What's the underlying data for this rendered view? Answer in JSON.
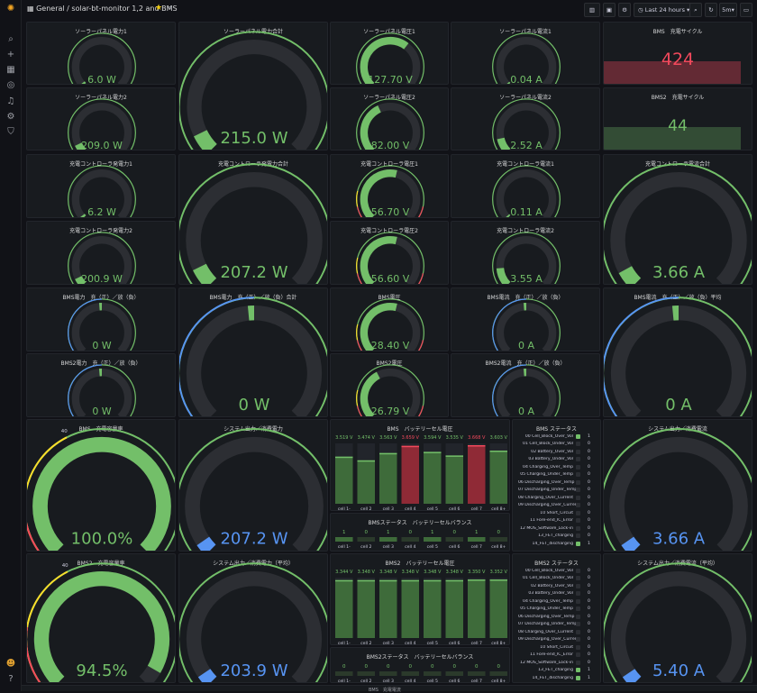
{
  "header": {
    "breadcrumb": "General / solar-bt-monitor 1,2 and BMS",
    "time_range": "Last 24 hours",
    "refresh": "5m"
  },
  "colors": {
    "green": "#73bf69",
    "red": "#f2495c",
    "blue": "#5794f2",
    "yellow": "#fade2a",
    "track": "#2c2e33"
  },
  "gauges": [
    {
      "id": "g1",
      "title": "ソーラーパネル電力1",
      "value": "6.0 W",
      "fill": 0.02,
      "color": "green"
    },
    {
      "id": "g2",
      "title": "ソーラーパネル電力2",
      "value": "209.0 W",
      "fill": 0.07,
      "color": "green"
    },
    {
      "id": "g3",
      "title": "ソーラーパネル電力合計",
      "value": "215.0 W",
      "fill": 0.07,
      "color": "green",
      "min": "0",
      "max": "3000"
    },
    {
      "id": "g4",
      "title": "ソーラーパネル電圧1",
      "value": "127.70 V",
      "fill": 0.64,
      "color": "green"
    },
    {
      "id": "g5",
      "title": "ソーラーパネル電圧2",
      "value": "82.00 V",
      "fill": 0.41,
      "color": "green"
    },
    {
      "id": "g6",
      "title": "ソーラーパネル電流1",
      "value": "0.04 A",
      "fill": 0.01,
      "color": "green"
    },
    {
      "id": "g7",
      "title": "ソーラーパネル電流2",
      "value": "2.52 A",
      "fill": 0.12,
      "color": "green"
    },
    {
      "id": "g8",
      "title": "充電コントローラ発電力1",
      "value": "6.2 W",
      "fill": 0.02,
      "color": "green"
    },
    {
      "id": "g9",
      "title": "充電コントローラ発電力2",
      "value": "200.9 W",
      "fill": 0.07,
      "color": "green"
    },
    {
      "id": "g10",
      "title": "充電コントローラ発電力合計",
      "value": "207.2 W",
      "fill": 0.07,
      "color": "green",
      "min": "0",
      "max": "3000"
    },
    {
      "id": "g11",
      "title": "充電コントローラ電圧1",
      "value": "56.70 V",
      "fill": 0.55,
      "color": "green",
      "min": "24.0",
      "max": "0.1"
    },
    {
      "id": "g12",
      "title": "充電コントローラ電圧2",
      "value": "56.60 V",
      "fill": 0.55,
      "color": "green",
      "min": "24.0",
      "max": "0.1"
    },
    {
      "id": "g13",
      "title": "充電コントローラ電流1",
      "value": "0.11 A",
      "fill": 0.01,
      "color": "green"
    },
    {
      "id": "g14",
      "title": "充電コントローラ電流2",
      "value": "3.55 A",
      "fill": 0.15,
      "color": "green"
    },
    {
      "id": "g15",
      "title": "充電コントローラ電流合計",
      "value": "3.66 A",
      "fill": 0.06,
      "color": "green"
    },
    {
      "id": "g16",
      "title": "BMS電力　充（正）／放（負）",
      "value": "0 W",
      "fill": 0.5,
      "color": "green",
      "startColor": "blue"
    },
    {
      "id": "g17",
      "title": "BMS2電力　充（正）／放（負）",
      "value": "0 W",
      "fill": 0.5,
      "color": "green",
      "startColor": "blue"
    },
    {
      "id": "g18",
      "title": "BMS電力　充（正）／放（負）合計",
      "value": "0 W",
      "fill": 0.5,
      "color": "green",
      "startColor": "blue",
      "min": "-1500",
      "max": "3000"
    },
    {
      "id": "g19",
      "title": "BMS電圧",
      "value": "28.40 V",
      "fill": 0.55,
      "color": "green",
      "min": "24.0"
    },
    {
      "id": "g20",
      "title": "BMS2電圧",
      "value": "26.79 V",
      "fill": 0.4,
      "color": "green",
      "min": "24.0"
    },
    {
      "id": "g21",
      "title": "BMS電流　充（正）／放（負）",
      "value": "0 A",
      "fill": 0.5,
      "color": "green",
      "startColor": "blue"
    },
    {
      "id": "g22",
      "title": "BMS2電流　充（正）／放（負）",
      "value": "0 A",
      "fill": 0.5,
      "color": "green",
      "startColor": "blue"
    },
    {
      "id": "g23",
      "title": "BMS電流　充（正）／放（負）平均",
      "value": "0 A",
      "fill": 0.5,
      "color": "green",
      "startColor": "blue",
      "min": "-60",
      "max": "120"
    },
    {
      "id": "g24",
      "title": "BMS　充電容量率",
      "value": "100.0%",
      "fill": 1.0,
      "color": "green",
      "min": "0",
      "max": "100",
      "ticks": [
        "20",
        "40"
      ]
    },
    {
      "id": "g25",
      "title": "システム出力／消費電力",
      "value": "207.2 W",
      "fill": 0.04,
      "color": "blue",
      "min": "0",
      "max": "100"
    },
    {
      "id": "g26",
      "title": "システム出力／消費電流",
      "value": "3.66 A",
      "fill": 0.04,
      "color": "blue",
      "min": "0",
      "max": "120"
    },
    {
      "id": "g27",
      "title": "BMS2　充電容量率",
      "value": "94.5%",
      "fill": 0.945,
      "color": "green",
      "min": "0",
      "max": "100",
      "ticks": [
        "20",
        "40"
      ]
    },
    {
      "id": "g28",
      "title": "システム出力／消費電力（平均）",
      "value": "203.9 W",
      "fill": 0.04,
      "color": "blue",
      "min": "0",
      "max": "3000"
    },
    {
      "id": "g29",
      "title": "システム出力／消費電流（平均）",
      "value": "5.40 A",
      "fill": 0.04,
      "color": "blue",
      "min": "0",
      "max": "120"
    }
  ],
  "stats": [
    {
      "title": "BMS　充電サイクル",
      "value": "424",
      "color": "red"
    },
    {
      "title": "BMS2　充電サイクル",
      "value": "44",
      "color": "green"
    }
  ],
  "cell_voltage": [
    {
      "title": "BMS　バッテリーセル電圧",
      "values": [
        "3.519 V",
        "3.474 V",
        "3.563 V",
        "3.659 V",
        "3.594 V",
        "3.535 V",
        "3.668 V",
        "3.603 V"
      ],
      "levels": [
        0.78,
        0.72,
        0.84,
        0.96,
        0.86,
        0.8,
        0.97,
        0.88
      ],
      "red": [
        false,
        false,
        false,
        true,
        false,
        false,
        true,
        false
      ],
      "labels": [
        "cell 1-",
        "cell 2",
        "cell 3",
        "cell 4",
        "cell 5",
        "cell 6",
        "cell 7",
        "cell 8+"
      ]
    },
    {
      "title": "BMS2　バッテリーセル電圧",
      "values": [
        "3.344 V",
        "3.348 V",
        "3.348 V",
        "3.348 V",
        "3.348 V",
        "3.348 V",
        "3.350 V",
        "3.352 V"
      ],
      "levels": [
        0.96,
        0.96,
        0.96,
        0.96,
        0.96,
        0.96,
        0.97,
        0.97
      ],
      "red": [
        false,
        false,
        false,
        false,
        false,
        false,
        false,
        false
      ],
      "labels": [
        "cell 1-",
        "cell 2",
        "cell 3",
        "cell 4",
        "cell 5",
        "cell 6",
        "cell 7",
        "cell 8+"
      ]
    }
  ],
  "cell_balance": [
    {
      "title": "BMSステータス　バッテリーセルバランス",
      "values": [
        "1",
        "0",
        "1",
        "0",
        "1",
        "0",
        "1",
        "0"
      ],
      "labels": [
        "cell 1-",
        "cell 2",
        "cell 3",
        "cell 4",
        "cell 5",
        "cell 6",
        "cell 7",
        "cell 8+"
      ]
    },
    {
      "title": "BMS2ステータス　バッテリーセルバランス",
      "values": [
        "0",
        "0",
        "0",
        "0",
        "0",
        "0",
        "0",
        "0"
      ],
      "labels": [
        "cell 1-",
        "cell 2",
        "cell 3",
        "cell 4",
        "cell 5",
        "cell 6",
        "cell 7",
        "cell 8+"
      ]
    }
  ],
  "status": [
    {
      "title": "BMS ステータス",
      "items": [
        [
          "00 Cell_Block_Over_Vol",
          "1",
          true
        ],
        [
          "01 Cell_Block_Under_Vol",
          "0",
          false
        ],
        [
          "02 Battery_Over_Vol",
          "0",
          false
        ],
        [
          "03 Battery_Under_Vol",
          "0",
          false
        ],
        [
          "04 Charging_Over_Temp",
          "0",
          false
        ],
        [
          "05 Charging_Under_Temp",
          "0",
          false
        ],
        [
          "06 Discharging_Over_Temp",
          "0",
          false
        ],
        [
          "07 Discharging_Under_Temp",
          "0",
          false
        ],
        [
          "08 Charging_Over_Current",
          "0",
          false
        ],
        [
          "09 Discharging_Over_Current",
          "0",
          false
        ],
        [
          "10 Short_Circuit",
          "0",
          false
        ],
        [
          "11 Fore-end_IC_Error",
          "0",
          false
        ],
        [
          "12 MOS_Software_Lock-in",
          "0",
          false
        ],
        [
          "13_FET_charging",
          "0",
          false
        ],
        [
          "14_FET_discharging",
          "1",
          true
        ]
      ]
    },
    {
      "title": "BMS2 ステータス",
      "items": [
        [
          "00 Cell_Block_Over_Vol",
          "0",
          false
        ],
        [
          "01 Cell_Block_Under_Vol",
          "0",
          false
        ],
        [
          "02 Battery_Over_Vol",
          "0",
          false
        ],
        [
          "03 Battery_Under_Vol",
          "0",
          false
        ],
        [
          "04 Charging_Over_Temp",
          "0",
          false
        ],
        [
          "05 Charging_Under_Temp",
          "0",
          false
        ],
        [
          "06 Discharging_Over_Temp",
          "0",
          false
        ],
        [
          "07 Discharging_Under_Temp",
          "0",
          false
        ],
        [
          "08 Charging_Over_Current",
          "0",
          false
        ],
        [
          "09 Discharging_Over_Current",
          "0",
          false
        ],
        [
          "10 Short_Circuit",
          "0",
          false
        ],
        [
          "11 Fore-end_IC_Error",
          "0",
          false
        ],
        [
          "12 MOS_Software_Lock-in",
          "0",
          false
        ],
        [
          "13_FET_charging",
          "1",
          true
        ],
        [
          "14_FET_discharging",
          "1",
          true
        ]
      ]
    }
  ],
  "bottom": {
    "title": "BMS　充電電流"
  }
}
